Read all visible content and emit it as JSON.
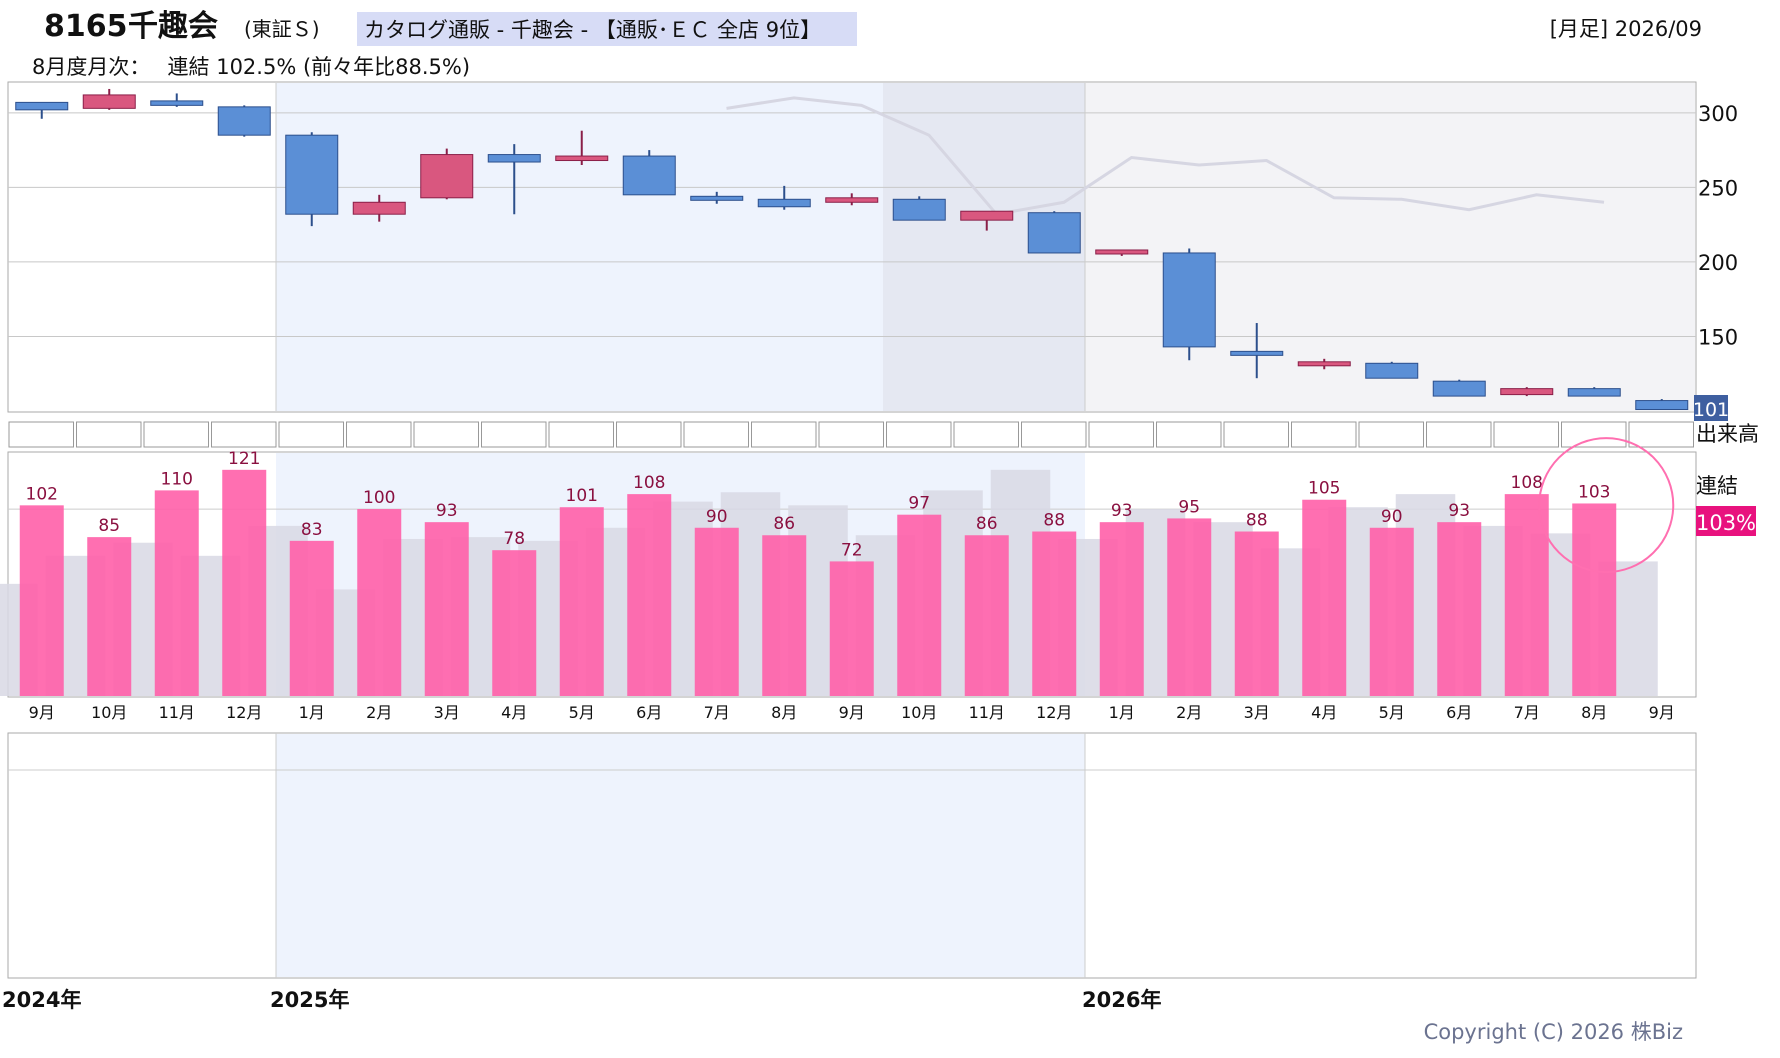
{
  "header": {
    "code": "8165",
    "name": "千趣会",
    "market": "(東証Ｓ)",
    "category": "カタログ通販 - 千趣会 - 【通販･ＥＣ 全店 9位】",
    "period": "[月足] 2026/09",
    "monthly_report": "8月度月次：　 連結 102.5% (前々年比88.5%)"
  },
  "labels": {
    "volume": "出来高",
    "consolidated": "連結",
    "ratio_badge": "103%",
    "copyright": "Copyright (C) 2026 株Biz"
  },
  "years": [
    "2024年",
    "2025年",
    "2026年"
  ],
  "colors": {
    "up_candle": "#d9577f",
    "down_candle": "#5b8fd6",
    "bar": "#ff5fa8",
    "prior_bar": "#d8d8e4",
    "highlight_circle": "#ff6fb0",
    "badge": "#e8127e"
  },
  "chart_data": [
    {
      "type": "candlestick",
      "title": "",
      "ylim": [
        100,
        320
      ],
      "yticks": [
        150,
        200,
        250,
        300
      ],
      "last_price_label": "101",
      "categories": [
        "2024-09",
        "2024-10",
        "2024-11",
        "2024-12",
        "2025-01",
        "2025-02",
        "2025-03",
        "2025-04",
        "2025-05",
        "2025-06",
        "2025-07",
        "2025-08",
        "2025-09",
        "2025-10",
        "2025-11",
        "2025-12",
        "2026-01",
        "2026-02",
        "2026-03",
        "2026-04",
        "2026-05",
        "2026-06",
        "2026-07",
        "2026-08",
        "2026-09"
      ],
      "ohlc": [
        [
          307,
          307,
          296,
          302
        ],
        [
          303,
          316,
          302,
          312
        ],
        [
          308,
          313,
          304,
          305
        ],
        [
          304,
          305,
          284,
          285
        ],
        [
          285,
          287,
          224,
          232
        ],
        [
          232,
          245,
          227,
          240
        ],
        [
          243,
          276,
          242,
          272
        ],
        [
          272,
          279,
          232,
          267
        ],
        [
          268,
          288,
          265,
          271
        ],
        [
          271,
          275,
          245,
          245
        ],
        [
          244,
          247,
          239,
          242
        ],
        [
          242,
          251,
          235,
          237
        ],
        [
          240,
          246,
          238,
          243
        ],
        [
          242,
          244,
          228,
          228
        ],
        [
          228,
          234,
          221,
          234
        ],
        [
          233,
          234,
          206,
          206
        ],
        [
          206,
          208,
          204,
          208
        ],
        [
          206,
          209,
          134,
          143
        ],
        [
          140,
          159,
          122,
          138
        ],
        [
          133,
          135,
          128,
          133
        ],
        [
          132,
          133,
          122,
          122
        ],
        [
          120,
          121,
          110,
          110
        ],
        [
          111,
          116,
          110,
          115
        ],
        [
          115,
          116,
          110,
          110
        ],
        [
          107,
          108,
          101,
          101
        ]
      ],
      "prior_year_line": [
        303,
        310,
        305,
        285,
        232,
        240,
        270,
        265,
        268,
        243,
        242,
        235,
        245,
        240
      ]
    },
    {
      "type": "bar",
      "title": "連結",
      "categories": [
        "9月",
        "10月",
        "11月",
        "12月",
        "1月",
        "2月",
        "3月",
        "4月",
        "5月",
        "6月",
        "7月",
        "8月",
        "9月",
        "10月",
        "11月",
        "12月",
        "1月",
        "2月",
        "3月",
        "4月",
        "5月",
        "6月",
        "7月",
        "8月",
        "9月"
      ],
      "series": [
        {
          "name": "連結",
          "values": [
            102,
            85,
            110,
            121,
            83,
            100,
            93,
            78,
            101,
            108,
            90,
            86,
            72,
            97,
            86,
            88,
            93,
            95,
            88,
            105,
            90,
            93,
            108,
            103,
            null
          ]
        },
        {
          "name": "",
          "values": [
            60,
            75,
            82,
            75,
            91,
            57,
            84,
            85,
            83,
            90,
            104,
            109,
            102,
            86,
            110,
            121,
            84,
            100,
            93,
            79,
            101,
            108,
            91,
            87,
            72
          ]
        }
      ],
      "highlight": "8月",
      "ylim": [
        0,
        130
      ],
      "reference_line": 100
    }
  ]
}
